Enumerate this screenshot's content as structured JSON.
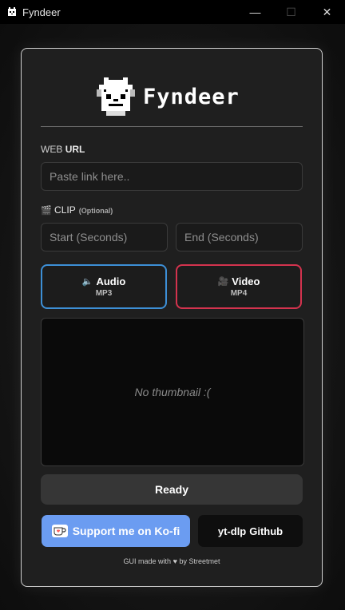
{
  "window": {
    "title": "Fyndeer",
    "controls": [
      "—",
      "☐",
      "✕"
    ]
  },
  "logo": {
    "text": "Fyndeer"
  },
  "url": {
    "label_a": "WEB",
    "label_b": "URL",
    "placeholder": "Paste link here.."
  },
  "clip": {
    "icon": "🎬",
    "label": "CLIP",
    "optional": "(Optional)",
    "start_placeholder": "Start (Seconds)",
    "end_placeholder": "End (Seconds)"
  },
  "formats": {
    "audio": {
      "icon": "🔈",
      "label": "Audio",
      "ext": "MP3",
      "color": "#3d8fd6"
    },
    "video": {
      "icon": "🎥",
      "label": "Video",
      "ext": "MP4",
      "color": "#d4334e"
    }
  },
  "thumbnail": {
    "empty_text": "No thumbnail :("
  },
  "status": {
    "text": "Ready"
  },
  "links": {
    "kofi": "Support me on Ko-fi",
    "github_a": "yt-dlp",
    "github_b": "Github"
  },
  "footer": {
    "prefix": "GUI made with",
    "heart": "♥",
    "suffix": "by Streetmet"
  }
}
